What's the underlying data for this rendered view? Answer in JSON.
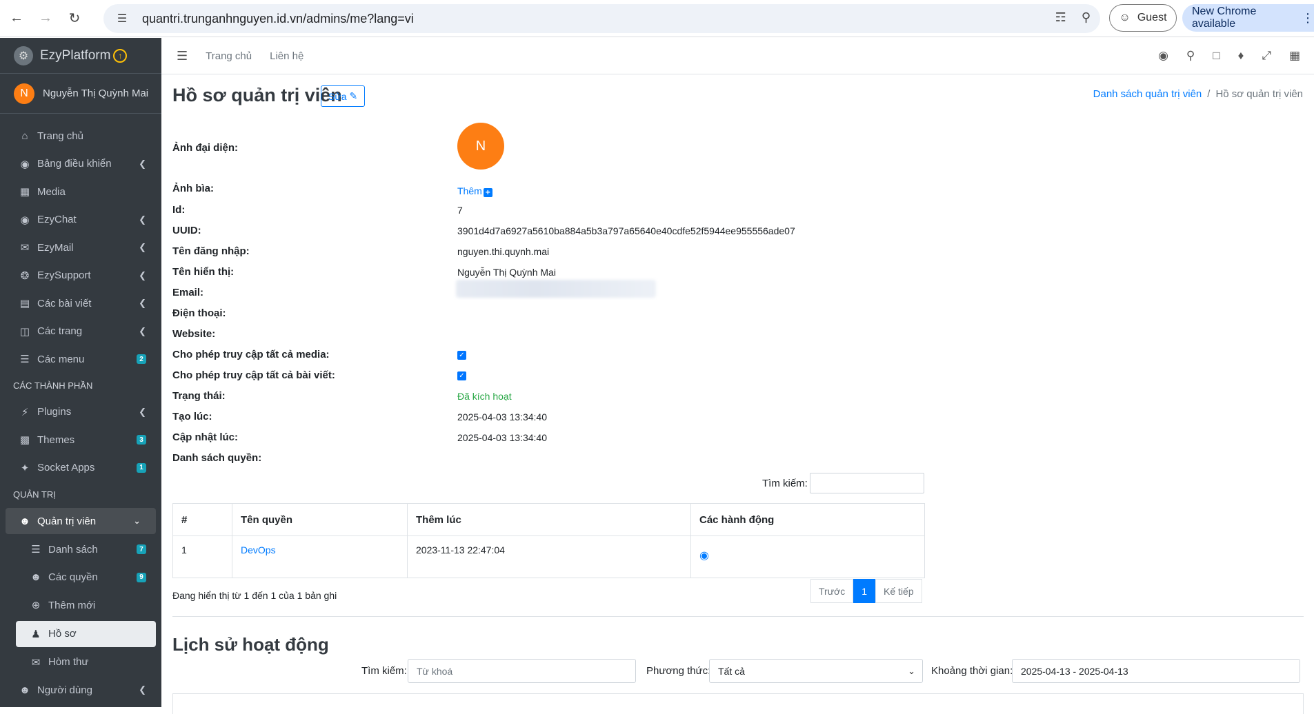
{
  "browser": {
    "url": "quantri.trunganhnguyen.id.vn/admins/me?lang=vi",
    "guest_label": "Guest",
    "chrome_update_label": "New Chrome available"
  },
  "sidebar": {
    "brand": "EzyPlatform",
    "user_initial": "N",
    "user_name": "Nguyễn Thị Quỳnh Mai",
    "items": [
      {
        "label": "Trang chủ",
        "icon": "home-icon"
      },
      {
        "label": "Bảng điều khiển",
        "icon": "dashboard-icon"
      },
      {
        "label": "Media",
        "icon": "image-icon"
      },
      {
        "label": "EzyChat",
        "icon": "chat-icon"
      },
      {
        "label": "EzyMail",
        "icon": "mail-icon"
      },
      {
        "label": "EzySupport",
        "icon": "support-icon"
      },
      {
        "label": "Các bài viết",
        "icon": "posts-icon"
      },
      {
        "label": "Các trang",
        "icon": "pages-icon"
      },
      {
        "label": "Các menu",
        "icon": "menu-icon",
        "badge": "2"
      }
    ],
    "section_components": "CÁC THÀNH PHẦN",
    "component_items": [
      {
        "label": "Plugins",
        "icon": "plug-icon"
      },
      {
        "label": "Themes",
        "icon": "themes-icon",
        "badge": "3"
      },
      {
        "label": "Socket Apps",
        "icon": "socket-icon",
        "badge": "1"
      }
    ],
    "section_admin": "QUẢN TRỊ",
    "admin_group_label": "Quản trị viên",
    "admin_sub": [
      {
        "label": "Danh sách",
        "icon": "list-icon",
        "badge": "7"
      },
      {
        "label": "Các quyền",
        "icon": "users-icon",
        "badge": "9"
      },
      {
        "label": "Thêm mới",
        "icon": "plus-circle-icon"
      },
      {
        "label": "Hồ sơ",
        "icon": "user-icon"
      },
      {
        "label": "Hòm thư",
        "icon": "inbox-icon"
      }
    ],
    "users_label": "Người dùng"
  },
  "topnav": {
    "home_link": "Trang chủ",
    "contact_link": "Liên hệ"
  },
  "page": {
    "title": "Hồ sơ quản trị viên",
    "edit_label": "Sửa",
    "breadcrumb_parent": "Danh sách quản trị viên",
    "breadcrumb_separator": "/",
    "breadcrumb_current": "Hồ sơ quản trị viên"
  },
  "profile": {
    "avatar_label": "Ảnh đại diện:",
    "avatar_initial": "N",
    "cover_label": "Ảnh bìa:",
    "cover_add": "Thêm",
    "id_label": "Id:",
    "id_value": "7",
    "uuid_label": "UUID:",
    "uuid_value": "3901d4d7a6927a5610ba884a5b3a797a65640e40cdfe52f5944ee955556ade07",
    "username_label": "Tên đăng nhập:",
    "username_value": "nguyen.thi.quynh.mai",
    "display_label": "Tên hiển thị:",
    "display_value": "Nguyễn Thị Quỳnh Mai",
    "email_label": "Email:",
    "phone_label": "Điện thoại:",
    "website_label": "Website:",
    "media_access_label": "Cho phép truy cập tất cả media:",
    "media_access_checked": true,
    "posts_access_label": "Cho phép truy cập tất cả bài viết:",
    "posts_access_checked": true,
    "status_label": "Trạng thái:",
    "status_value": "Đã kích hoạt",
    "created_label": "Tạo lúc:",
    "created_value": "2025-04-03 13:34:40",
    "updated_label": "Cập nhật lúc:",
    "updated_value": "2025-04-03 13:34:40",
    "roles_label": "Danh sách quyền:"
  },
  "roles_table": {
    "search_label": "Tìm kiếm:",
    "columns": [
      "#",
      "Tên quyền",
      "Thêm lúc",
      "Các hành động"
    ],
    "rows": [
      {
        "index": "1",
        "name": "DevOps",
        "added": "2023-11-13 22:47:04"
      }
    ],
    "info": "Đang hiển thị từ 1 đến 1 của 1 bản ghi",
    "prev": "Trước",
    "page": "1",
    "next": "Kế tiếp"
  },
  "history": {
    "title": "Lịch sử hoạt động",
    "search_label": "Tìm kiếm:",
    "search_placeholder": "Từ khoá",
    "method_label": "Phương thức:",
    "method_value": "Tất cả",
    "range_label": "Khoảng thời gian:",
    "range_value": "2025-04-13 - 2025-04-13"
  },
  "colors": {
    "sidebar_bg": "#343a40",
    "primary": "#007bff",
    "avatar": "#fd7e14",
    "success": "#28a745",
    "badge": "#17a2b8"
  }
}
